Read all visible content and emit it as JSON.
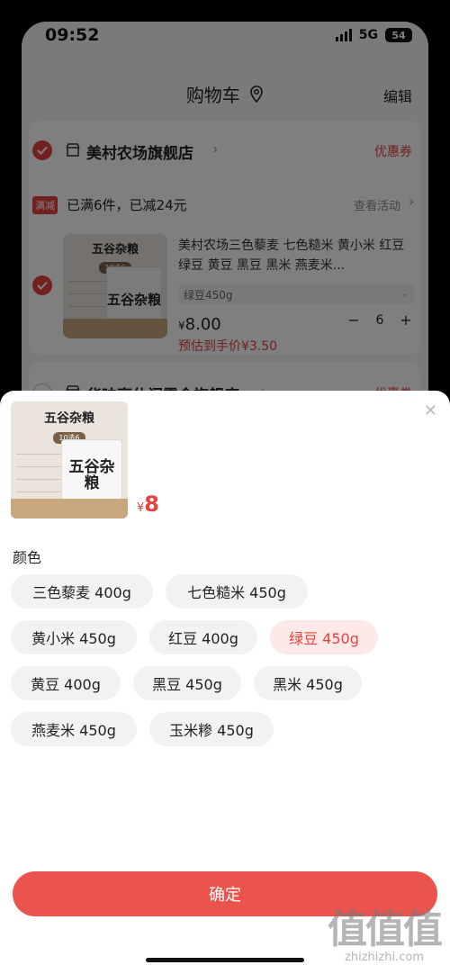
{
  "status_bar": {
    "time": "09:52",
    "network": "5G",
    "battery": "54"
  },
  "nav": {
    "title": "购物车",
    "edit": "编辑"
  },
  "store1": {
    "name": "美村农场旗舰店",
    "coupon": "优惠券",
    "promo_badge": "满减",
    "promo_text": "已满6件，已减24元",
    "see_activity": "查看活动",
    "product": {
      "title": "美村农场三色藜麦 七色糙米 黄小米 红豆 绿豆 黄豆 黑豆 黑米 燕麦米...",
      "spec": "绿豆450g",
      "price_symbol": "¥",
      "price": "8.00",
      "estimate": "预估到手价¥3.50",
      "qty_minus": "−",
      "qty": "6",
      "qty_plus": "+"
    }
  },
  "store2": {
    "name": "华味亨休闲零食旗舰店",
    "coupon": "优惠券"
  },
  "product_image": {
    "title": "五谷杂粮",
    "subtitle": "10选6",
    "bag_text": "五谷杂粮"
  },
  "sheet": {
    "price_symbol": "¥",
    "price": "8",
    "section_label": "颜色",
    "options": [
      {
        "label": "三色藜麦 400g",
        "selected": false
      },
      {
        "label": "七色糙米 450g",
        "selected": false
      },
      {
        "label": "黄小米 450g",
        "selected": false
      },
      {
        "label": "红豆 400g",
        "selected": false
      },
      {
        "label": "绿豆 450g",
        "selected": true
      },
      {
        "label": "黄豆 400g",
        "selected": false
      },
      {
        "label": "黑豆 450g",
        "selected": false
      },
      {
        "label": "黑米 450g",
        "selected": false
      },
      {
        "label": "燕麦米 450g",
        "selected": false
      },
      {
        "label": "玉米糁 450g",
        "selected": false
      }
    ],
    "confirm": "确定"
  },
  "watermark": {
    "logo": "值值值",
    "domain": "zhizhizhi.com"
  },
  "colors": {
    "accent": "#e5433d",
    "confirm": "#ea544d",
    "chip_bg": "#f2f2f2",
    "chip_selected_bg": "#fde9e8"
  }
}
